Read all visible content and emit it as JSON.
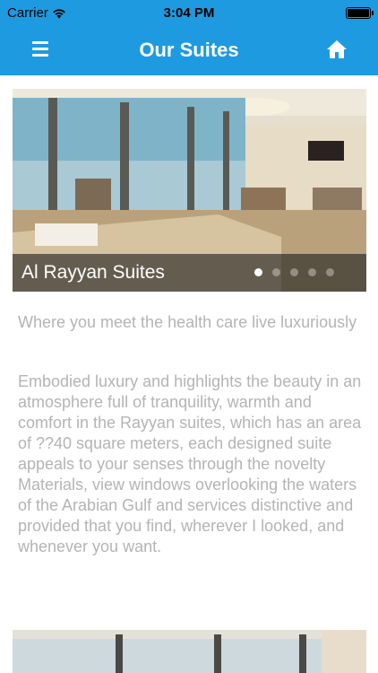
{
  "status_bar": {
    "carrier": "Carrier",
    "time": "3:04 PM",
    "battery_level": 1.0
  },
  "nav": {
    "title": "Our Suites",
    "menu_icon": "hamburger-menu-icon",
    "home_icon": "home-icon"
  },
  "colors": {
    "nav_background": "#1e9ae0",
    "body_text": "#b4b4b4",
    "caption_overlay": "#1e1e1e"
  },
  "slider": {
    "caption": "Al Rayyan Suites",
    "dot_count": 5,
    "active_dot": 0
  },
  "suite": {
    "tagline": "Where you meet the health care live luxuriously",
    "description": "Embodied luxury and highlights the beauty in an atmosphere full of tranquility, warmth and comfort in the Rayyan suites, which has an area of ??40 square meters, each designed suite appeals to your senses through the novelty Materials, view windows overlooking the waters of the Arabian Gulf and services distinctive and provided that you find, wherever I looked, and whenever you want."
  }
}
